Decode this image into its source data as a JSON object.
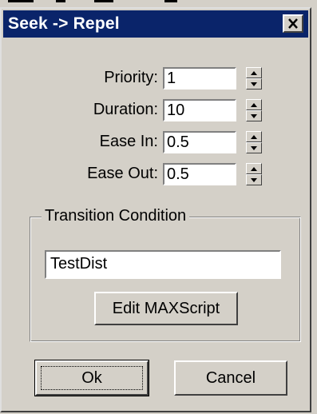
{
  "window": {
    "title": "Seek -> Repel",
    "close_icon": "close-icon"
  },
  "fields": [
    {
      "label": "Priority:",
      "value": "1"
    },
    {
      "label": "Duration:",
      "value": "10"
    },
    {
      "label": "Ease In:",
      "value": "0.5"
    },
    {
      "label": "Ease Out:",
      "value": "0.5"
    }
  ],
  "transition": {
    "legend": "Transition Condition",
    "value": "TestDist",
    "edit_button": "Edit MAXScript"
  },
  "buttons": {
    "ok": "Ok",
    "cancel": "Cancel"
  }
}
